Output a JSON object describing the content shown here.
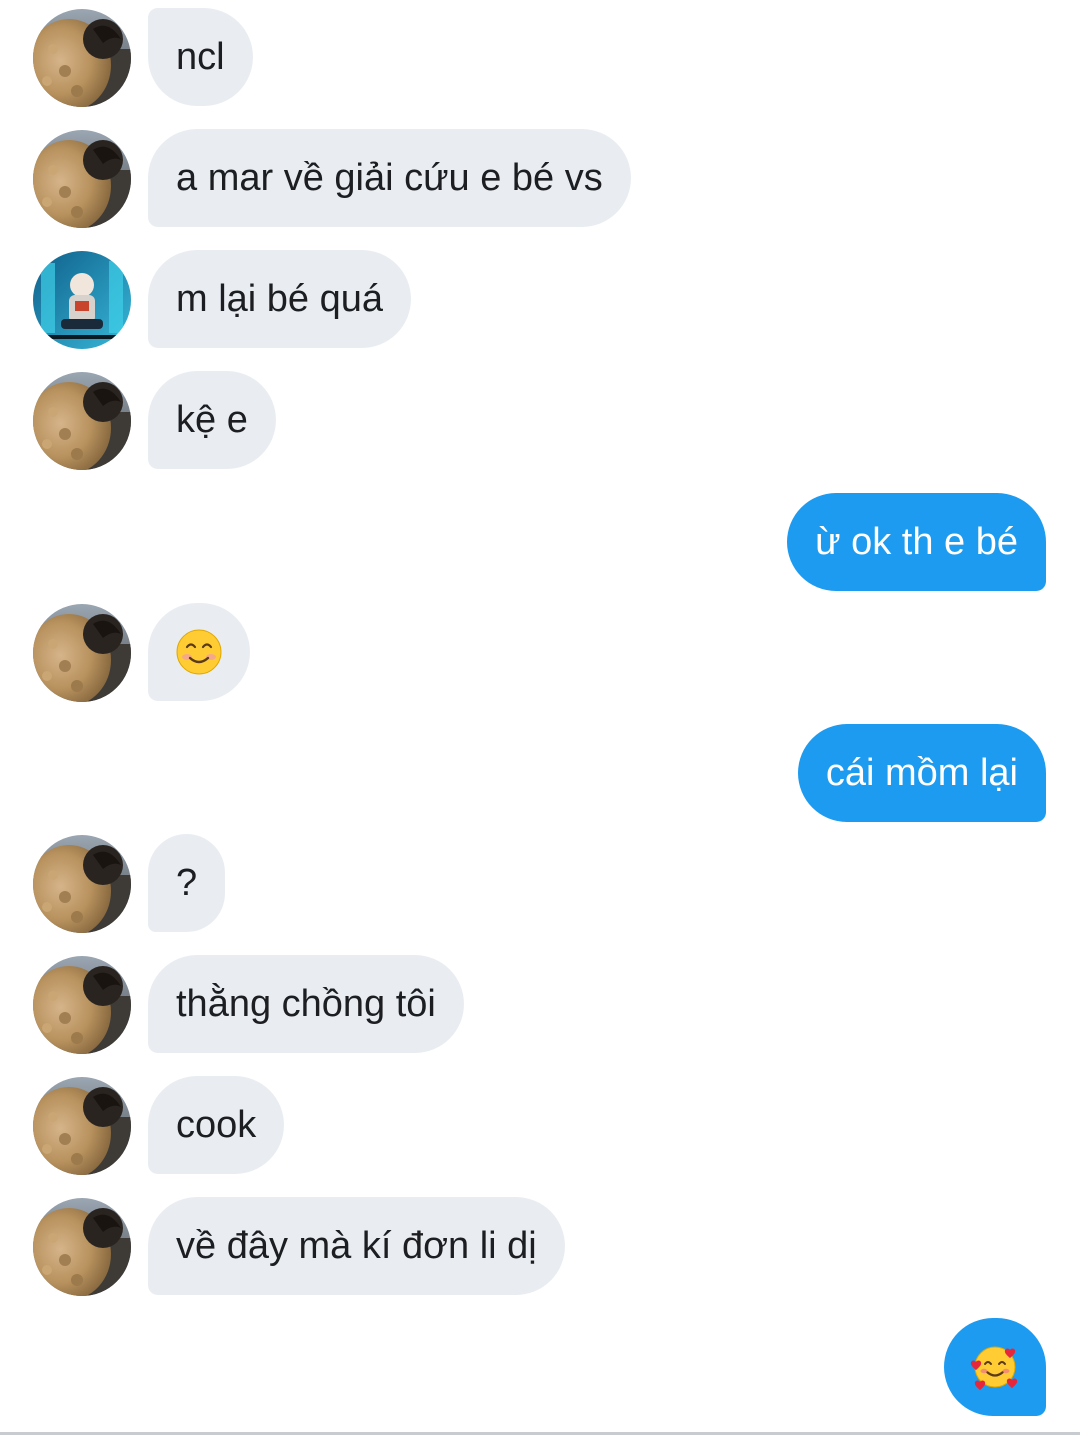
{
  "chat": {
    "messages": [
      {
        "sender": "them",
        "avatar": "teddy-coat-avatar",
        "text": "ncl"
      },
      {
        "sender": "them",
        "avatar": "teddy-coat-avatar",
        "text": "a mar về giải cứu e bé vs"
      },
      {
        "sender": "them",
        "avatar": "blue-poster-avatar",
        "text": "m lại bé quá"
      },
      {
        "sender": "them",
        "avatar": "teddy-coat-avatar",
        "text": "kệ e"
      },
      {
        "sender": "me",
        "text": "ừ ok th e bé"
      },
      {
        "sender": "them",
        "avatar": "teddy-coat-avatar",
        "emoji": "smiling-face-emoji",
        "text": "😊"
      },
      {
        "sender": "me",
        "text": "cái mồm lại"
      },
      {
        "sender": "them",
        "avatar": "teddy-coat-avatar",
        "text": "?"
      },
      {
        "sender": "them",
        "avatar": "teddy-coat-avatar",
        "text": "thằng chồng tôi"
      },
      {
        "sender": "them",
        "avatar": "teddy-coat-avatar",
        "text": "cook"
      },
      {
        "sender": "them",
        "avatar": "teddy-coat-avatar",
        "text": "về đây mà kí đơn li dị"
      },
      {
        "sender": "me",
        "emoji": "smiling-face-with-hearts-emoji",
        "text": "🥰"
      }
    ]
  },
  "colors": {
    "incoming_bubble": "#e9edf2",
    "outgoing_bubble": "#1d9bf0",
    "incoming_text": "#1c1e21",
    "outgoing_text": "#ffffff"
  }
}
